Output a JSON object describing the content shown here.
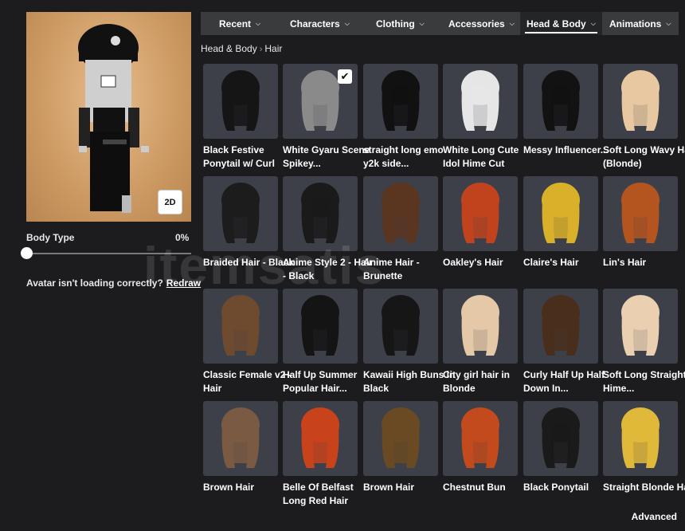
{
  "tabs": [
    {
      "label": "Recent"
    },
    {
      "label": "Characters"
    },
    {
      "label": "Clothing"
    },
    {
      "label": "Accessories"
    },
    {
      "label": "Head & Body"
    },
    {
      "label": "Animations"
    }
  ],
  "breadcrumb": {
    "parent": "Head & Body",
    "current": "Hair"
  },
  "avatar": {
    "toggle_label": "2D"
  },
  "body_type": {
    "label": "Body Type",
    "value": "0%"
  },
  "loading": {
    "text": "Avatar isn't loading correctly?",
    "link": "Redraw"
  },
  "watermark": "itemsatis",
  "items": [
    {
      "label": "Black Festive Ponytail w/ Curl",
      "color": "#151515",
      "selected": false
    },
    {
      "label": "White Gyaru Scene Spikey...",
      "color": "#8a8a8a",
      "selected": true
    },
    {
      "label": "straight long emo y2k side...",
      "color": "#111111",
      "selected": false
    },
    {
      "label": "White Long Cute Idol Hime Cut",
      "color": "#e6e6e6",
      "selected": false
    },
    {
      "label": "Messy Influencer...",
      "color": "#121212",
      "selected": false
    },
    {
      "label": "Soft Long Wavy Hair (Blonde)",
      "color": "#e8c8a0",
      "selected": false
    },
    {
      "label": "Braided Hair - Black",
      "color": "#1c1c1c",
      "selected": false
    },
    {
      "label": "Anime Style 2 - Hair - Black",
      "color": "#1a1a1a",
      "selected": false
    },
    {
      "label": "Anime Hair - Brunette",
      "color": "#5a3520",
      "selected": false
    },
    {
      "label": "Oakley's Hair",
      "color": "#c0431d",
      "selected": false
    },
    {
      "label": "Claire's Hair",
      "color": "#d9b02a",
      "selected": false
    },
    {
      "label": "Lin's Hair",
      "color": "#b4551f",
      "selected": false
    },
    {
      "label": "Classic Female v2 - Hair",
      "color": "#6e4a2e",
      "selected": false
    },
    {
      "label": "Half Up Summer Popular Hair...",
      "color": "#141414",
      "selected": false
    },
    {
      "label": "Kawaii High Buns in Black",
      "color": "#161616",
      "selected": false
    },
    {
      "label": "City girl hair in Blonde",
      "color": "#e4c8a8",
      "selected": false
    },
    {
      "label": "Curly Half Up Half Down In...",
      "color": "#4a2e1c",
      "selected": false
    },
    {
      "label": "Soft Long Straight Hime...",
      "color": "#ead0b0",
      "selected": false
    },
    {
      "label": "Brown Hair",
      "color": "#7a5a42",
      "selected": false
    },
    {
      "label": "Belle Of Belfast Long Red Hair",
      "color": "#c8431c",
      "selected": false
    },
    {
      "label": "Brown Hair",
      "color": "#6a4a22",
      "selected": false
    },
    {
      "label": "Chestnut Bun",
      "color": "#c24a1c",
      "selected": false
    },
    {
      "label": "Black Ponytail",
      "color": "#1a1a1a",
      "selected": false
    },
    {
      "label": "Straight Blonde Hair",
      "color": "#e0b83a",
      "selected": false
    }
  ],
  "footer": {
    "advanced": "Advanced"
  }
}
